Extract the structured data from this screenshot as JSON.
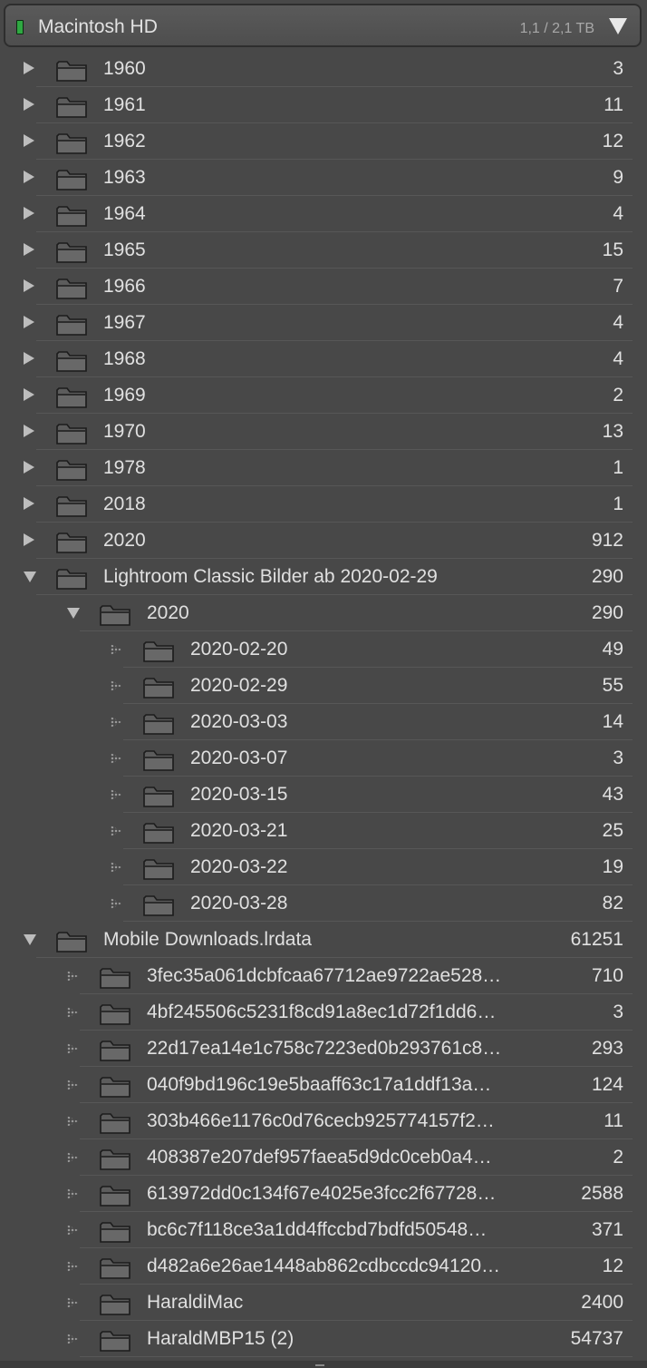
{
  "volume": {
    "name": "Macintosh HD",
    "usage": "1,1 / 2,1 TB",
    "status_color": "#2fa842"
  },
  "folders": [
    {
      "label": "1960",
      "count": "3",
      "level": 0,
      "state": "closed"
    },
    {
      "label": "1961",
      "count": "11",
      "level": 0,
      "state": "closed"
    },
    {
      "label": "1962",
      "count": "12",
      "level": 0,
      "state": "closed"
    },
    {
      "label": "1963",
      "count": "9",
      "level": 0,
      "state": "closed"
    },
    {
      "label": "1964",
      "count": "4",
      "level": 0,
      "state": "closed"
    },
    {
      "label": "1965",
      "count": "15",
      "level": 0,
      "state": "closed"
    },
    {
      "label": "1966",
      "count": "7",
      "level": 0,
      "state": "closed"
    },
    {
      "label": "1967",
      "count": "4",
      "level": 0,
      "state": "closed"
    },
    {
      "label": "1968",
      "count": "4",
      "level": 0,
      "state": "closed"
    },
    {
      "label": "1969",
      "count": "2",
      "level": 0,
      "state": "closed"
    },
    {
      "label": "1970",
      "count": "13",
      "level": 0,
      "state": "closed"
    },
    {
      "label": "1978",
      "count": "1",
      "level": 0,
      "state": "closed"
    },
    {
      "label": "2018",
      "count": "1",
      "level": 0,
      "state": "closed"
    },
    {
      "label": "2020",
      "count": "912",
      "level": 0,
      "state": "closed"
    },
    {
      "label": "Lightroom Classic Bilder ab 2020-02-29",
      "count": "290",
      "level": 0,
      "state": "open"
    },
    {
      "label": "2020",
      "count": "290",
      "level": 1,
      "state": "open"
    },
    {
      "label": "2020-02-20",
      "count": "49",
      "level": 2,
      "state": "empty"
    },
    {
      "label": "2020-02-29",
      "count": "55",
      "level": 2,
      "state": "empty"
    },
    {
      "label": "2020-03-03",
      "count": "14",
      "level": 2,
      "state": "empty"
    },
    {
      "label": "2020-03-07",
      "count": "3",
      "level": 2,
      "state": "empty"
    },
    {
      "label": "2020-03-15",
      "count": "43",
      "level": 2,
      "state": "empty"
    },
    {
      "label": "2020-03-21",
      "count": "25",
      "level": 2,
      "state": "empty"
    },
    {
      "label": "2020-03-22",
      "count": "19",
      "level": 2,
      "state": "empty"
    },
    {
      "label": "2020-03-28",
      "count": "82",
      "level": 2,
      "state": "empty"
    },
    {
      "label": "Mobile Downloads.lrdata",
      "count": "61251",
      "level": 0,
      "state": "open"
    },
    {
      "label": "3fec35a061dcbfcaa67712ae9722ae528…",
      "count": "710",
      "level": 1,
      "state": "empty"
    },
    {
      "label": "4bf245506c5231f8cd91a8ec1d72f1dd6…",
      "count": "3",
      "level": 1,
      "state": "empty"
    },
    {
      "label": "22d17ea14e1c758c7223ed0b293761c8…",
      "count": "293",
      "level": 1,
      "state": "empty"
    },
    {
      "label": "040f9bd196c19e5baaff63c17a1ddf13a…",
      "count": "124",
      "level": 1,
      "state": "empty"
    },
    {
      "label": "303b466e1176c0d76cecb925774157f2…",
      "count": "11",
      "level": 1,
      "state": "empty"
    },
    {
      "label": "408387e207def957faea5d9dc0ceb0a4…",
      "count": "2",
      "level": 1,
      "state": "empty"
    },
    {
      "label": "613972dd0c134f67e4025e3fcc2f67728…",
      "count": "2588",
      "level": 1,
      "state": "empty"
    },
    {
      "label": "bc6c7f118ce3a1dd4ffccbd7bdfd50548…",
      "count": "371",
      "level": 1,
      "state": "empty"
    },
    {
      "label": "d482a6e26ae1448ab862cdbccdc94120…",
      "count": "12",
      "level": 1,
      "state": "empty"
    },
    {
      "label": "HaraldiMac",
      "count": "2400",
      "level": 1,
      "state": "empty"
    },
    {
      "label": "HaraldMBP15 (2)",
      "count": "54737",
      "level": 1,
      "state": "empty"
    }
  ]
}
